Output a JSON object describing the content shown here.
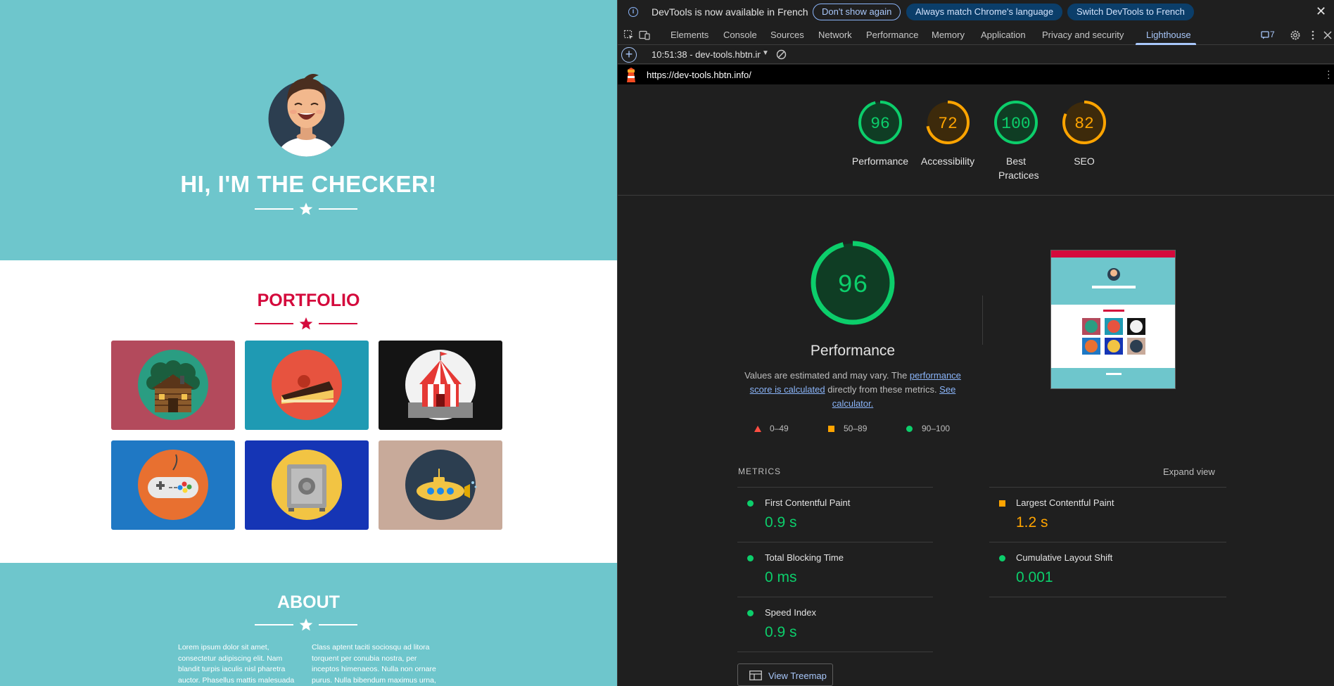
{
  "website": {
    "hero_title": "HI, I'M THE CHECKER!",
    "portfolio_title": "PORTFOLIO",
    "about_title": "ABOUT",
    "about_col1": "Lorem ipsum dolor sit amet, consectetur adipiscing elit. Nam blandit turpis iaculis nisl pharetra auctor. Phasellus mattis malesuada feugiat. Quisque malesuada",
    "about_col2": "Class aptent taciti sociosqu ad litora torquent per conubia nostra, per inceptos himenaeos. Nulla non ornare purus. Nulla bibendum maximus urna,",
    "colors": {
      "hero": "#6ec6cc",
      "accent": "#d40a3c"
    },
    "portfolio_tiles": [
      {
        "icon": "cabin-icon",
        "bg": "#b34a5c"
      },
      {
        "icon": "cake-icon",
        "bg": "#1f9ab3"
      },
      {
        "icon": "circus-tent-icon",
        "bg": "#141414"
      },
      {
        "icon": "game-controller-icon",
        "bg": "#1f78c4"
      },
      {
        "icon": "safe-icon",
        "bg": "#1535b5"
      },
      {
        "icon": "submarine-icon",
        "bg": "#c8aa9a"
      }
    ]
  },
  "devtools": {
    "infobar": {
      "message": "DevTools is now available in French",
      "dont_show": "Don't show again",
      "always_match": "Always match Chrome's language",
      "switch": "Switch DevTools to French"
    },
    "tabs": [
      "Elements",
      "Console",
      "Sources",
      "Network",
      "Performance",
      "Memory",
      "Application",
      "Privacy and security",
      "Lighthouse"
    ],
    "active_tab": "Lighthouse",
    "issues_count": "7",
    "report_select": "10:51:38 - dev-tools.hbtn.info",
    "url": "https://dev-tools.hbtn.info/",
    "scores": [
      {
        "label": "Performance",
        "value": 96,
        "color": "#0cce6b"
      },
      {
        "label": "Accessibility",
        "value": 72,
        "color": "#ffa400"
      },
      {
        "label": "Best Practices",
        "value": 100,
        "color": "#0cce6b"
      },
      {
        "label": "SEO",
        "value": 82,
        "color": "#ffa400"
      }
    ],
    "performance": {
      "score": 96,
      "title": "Performance",
      "desc_1": "Values are estimated and may vary. The ",
      "desc_link1": "performance score is calculated",
      "desc_2": " directly from these metrics. ",
      "desc_link2": "See calculator."
    },
    "legend": [
      {
        "range": "0–49",
        "color": "#ff4e42"
      },
      {
        "range": "50–89",
        "color": "#ffa400"
      },
      {
        "range": "90–100",
        "color": "#0cce6b"
      }
    ],
    "metrics_label": "METRICS",
    "expand_view": "Expand view",
    "metrics": [
      {
        "name": "First Contentful Paint",
        "value": "0.9 s",
        "status": "pass"
      },
      {
        "name": "Largest Contentful Paint",
        "value": "1.2 s",
        "status": "average"
      },
      {
        "name": "Total Blocking Time",
        "value": "0 ms",
        "status": "pass"
      },
      {
        "name": "Cumulative Layout Shift",
        "value": "0.001",
        "status": "pass"
      },
      {
        "name": "Speed Index",
        "value": "0.9 s",
        "status": "pass"
      }
    ],
    "view_treemap": "View Treemap"
  }
}
